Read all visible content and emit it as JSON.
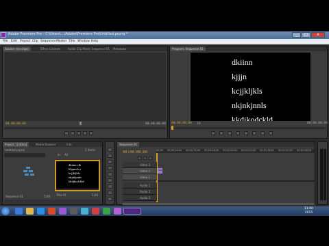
{
  "window": {
    "title": "Adobe Premiere Pro - C:\\Users\\...\\Adobe\\Premiere Pro\\Untitled.prproj *",
    "minimize": "_",
    "maximize": "□",
    "close": "x"
  },
  "menu": [
    "File",
    "Edit",
    "Project",
    "Clip",
    "Sequence",
    "Marker",
    "Title",
    "Window",
    "Help"
  ],
  "source_panel": {
    "tabs": [
      "Source: (no clips)",
      "Effect Controls",
      "Audio Clip Mixer: Sequence 01",
      "Metadata"
    ],
    "timecode_left": "00;00;00;00",
    "timecode_right": "00;00;00;00"
  },
  "program_panel": {
    "tab": "Program: Sequence 01",
    "title_lines": [
      "dkiinn",
      "kjjjn",
      "kcjjkljkls",
      "nkjnkjnnls",
      "kkdjkodckld"
    ],
    "timecode_left": "00;00;00;00",
    "fit": "Fit",
    "timecode_right": "00;00;00;00"
  },
  "project_panel": {
    "tabs": [
      "Project: Untitled",
      "Media Browser",
      "Info"
    ],
    "project_name": "Untitled.prproj",
    "item_count": "2 Items",
    "in_label": "In:",
    "in_value": "All",
    "bin_label": "Sequence 01",
    "bin_duration": "5;00",
    "thumb_lines": [
      "dkiinn clb",
      "kljqmcb a",
      "kcjjkljkls",
      "nkjnkjnnls",
      "kkdjkodckld"
    ],
    "thumb_name": "Title 01",
    "thumb_duration": "5;00"
  },
  "timeline": {
    "tab": "Sequence 01",
    "timecode": "00;00;00;00",
    "ruler": [
      "00;00",
      "00;00;16;00",
      "00;00;32;00",
      "00;00;48;00",
      "00;01;04;02",
      "00;01;20;02",
      "00;01;36;02",
      "00;01;52;02",
      "00;02;08;04"
    ],
    "video_tracks": [
      "Video 3",
      "Video 2",
      "Video 1"
    ],
    "audio_tracks": [
      "Audio 1",
      "Audio 2",
      "Audio 3"
    ],
    "clip_label": "Title"
  },
  "taskbar": {
    "time": "11:00",
    "date": "2015"
  }
}
